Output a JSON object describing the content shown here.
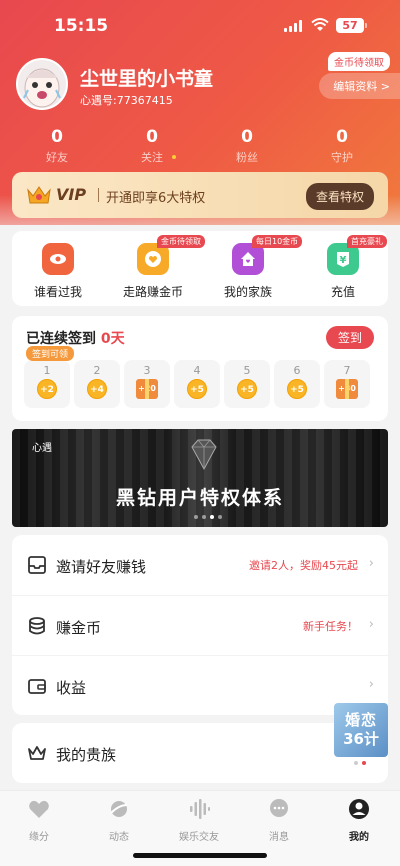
{
  "status_bar": {
    "time": "15:15",
    "battery": "57"
  },
  "profile": {
    "username": "尘世里的小书童",
    "user_id": "心遇号:77367415",
    "coin_pending_badge": "金币待领取",
    "edit_profile_label": "编辑资料 >"
  },
  "stats": [
    {
      "value": "0",
      "label": "好友"
    },
    {
      "value": "0",
      "label": "关注"
    },
    {
      "value": "0",
      "label": "粉丝"
    },
    {
      "value": "0",
      "label": "守护"
    }
  ],
  "vip": {
    "logo_text": "VIP",
    "description": "开通即享6大特权",
    "button_label": "查看特权"
  },
  "quick_actions": [
    {
      "label": "谁看过我",
      "badge": "",
      "icon": "eye-icon",
      "color": "#f0643e"
    },
    {
      "label": "走路赚金币",
      "badge": "金币待领取",
      "icon": "coin-heart-icon",
      "color": "#f7a928"
    },
    {
      "label": "我的家族",
      "badge": "每日10金币",
      "icon": "home-icon",
      "color": "#b14fd6"
    },
    {
      "label": "充值",
      "badge": "首充豪礼",
      "icon": "yen-icon",
      "color": "#3ec98f"
    }
  ],
  "signin": {
    "title_prefix": "已连续签到",
    "days_value": "0天",
    "button_label": "签到",
    "available_badge": "签到可领",
    "days": [
      {
        "num": "1",
        "reward": "+2",
        "type": "coin"
      },
      {
        "num": "2",
        "reward": "+4",
        "type": "coin"
      },
      {
        "num": "3",
        "reward": "+20",
        "type": "gift"
      },
      {
        "num": "4",
        "reward": "+5",
        "type": "coin"
      },
      {
        "num": "5",
        "reward": "+5",
        "type": "coin"
      },
      {
        "num": "6",
        "reward": "+5",
        "type": "coin"
      },
      {
        "num": "7",
        "reward": "+30",
        "type": "gift"
      }
    ]
  },
  "banner": {
    "logo": "心遇",
    "title": "黑钻用户特权体系"
  },
  "menu": [
    {
      "label": "邀请好友赚钱",
      "hint": "邀请2人，奖励45元起",
      "icon": "inbox-icon"
    },
    {
      "label": "赚金币",
      "hint": "新手任务！",
      "icon": "coins-stack-icon"
    },
    {
      "label": "收益",
      "hint": "",
      "icon": "wallet-icon"
    }
  ],
  "noble": {
    "label": "我的贵族",
    "icon": "crown-icon"
  },
  "float_ad": {
    "line1": "婚恋",
    "line2": "36计"
  },
  "tabs": [
    {
      "label": "缘分",
      "icon": "heart-icon",
      "active": false
    },
    {
      "label": "动态",
      "icon": "planet-icon",
      "active": false
    },
    {
      "label": "娱乐交友",
      "icon": "voice-wave-icon",
      "active": false
    },
    {
      "label": "消息",
      "icon": "chat-icon",
      "active": false
    },
    {
      "label": "我的",
      "icon": "profile-icon",
      "active": true
    }
  ],
  "colors": {
    "primary": "#e8484f",
    "gradient_end": "#f07a3c",
    "vip_gold": "#f5d7a8"
  }
}
